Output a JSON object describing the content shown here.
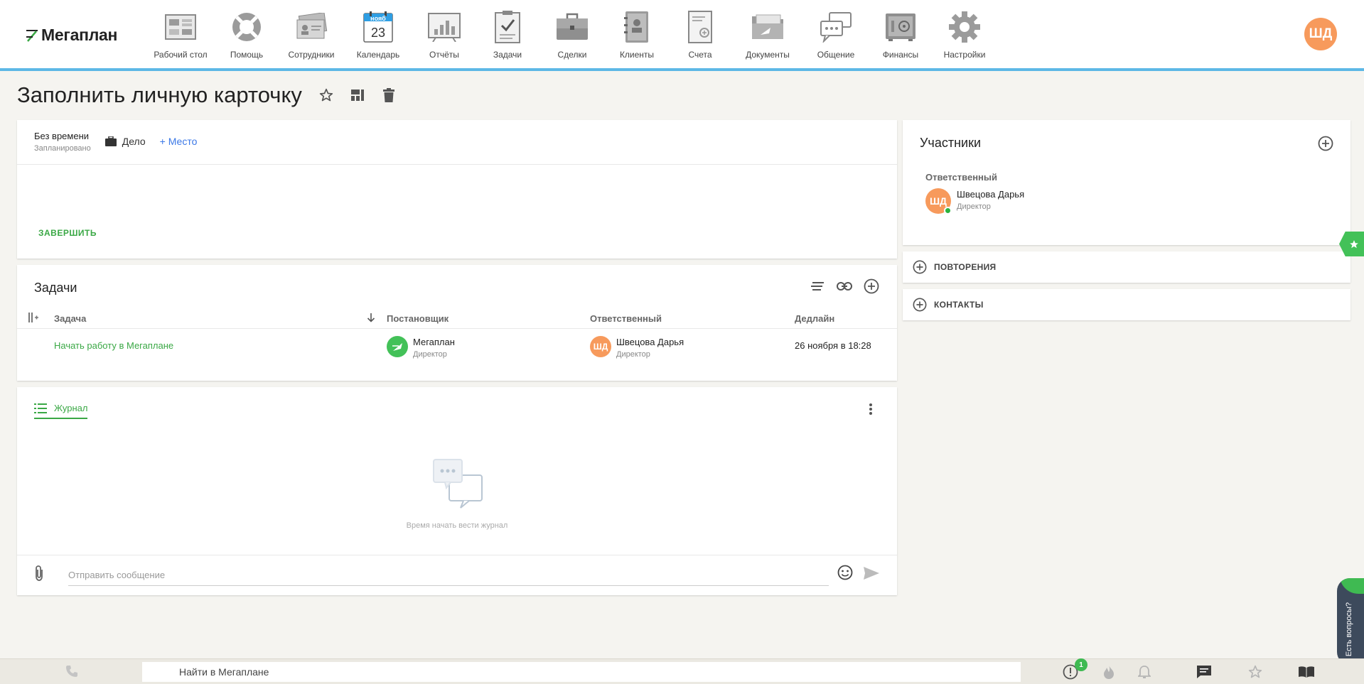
{
  "brand": {
    "logo_text": "Мегаплан"
  },
  "nav": {
    "items": [
      {
        "label": "Рабочий стол",
        "icon": "desktop-icon"
      },
      {
        "label": "Помощь",
        "icon": "lifebuoy-icon"
      },
      {
        "label": "Сотрудники",
        "icon": "employees-icon"
      },
      {
        "label": "Календарь",
        "icon": "calendar-icon",
        "cal_month": "нояб",
        "cal_day": "23"
      },
      {
        "label": "Отчёты",
        "icon": "reports-icon"
      },
      {
        "label": "Задачи",
        "icon": "tasks-icon"
      },
      {
        "label": "Сделки",
        "icon": "deals-icon"
      },
      {
        "label": "Клиенты",
        "icon": "clients-icon"
      },
      {
        "label": "Счета",
        "icon": "invoices-icon"
      },
      {
        "label": "Документы",
        "icon": "documents-icon"
      },
      {
        "label": "Общение",
        "icon": "chat-icon"
      },
      {
        "label": "Финансы",
        "icon": "safe-icon"
      },
      {
        "label": "Настройки",
        "icon": "gear-icon"
      }
    ],
    "user_initials": "ШД"
  },
  "page": {
    "title": "Заполнить личную карточку"
  },
  "event": {
    "time": "Без времени",
    "status": "Запланировано",
    "type": "Дело",
    "add_place": "+ Место",
    "finish_label": "ЗАВЕРШИТЬ"
  },
  "tasks": {
    "title": "Задачи",
    "columns": [
      "Задача",
      "Постановщик",
      "Ответственный",
      "Дедлайн"
    ],
    "rows": [
      {
        "task": "Начать работу в Мегаплане",
        "setter_name": "Мегаплан",
        "setter_role": "Директор",
        "resp_initials": "ШД",
        "resp_name": "Швецова Дарья",
        "resp_role": "Директор",
        "deadline": "26 ноября в 18:28"
      }
    ]
  },
  "journal": {
    "tab_label": "Журнал",
    "empty_text": "Время начать вести журнал",
    "message_placeholder": "Отправить сообщение"
  },
  "participants": {
    "title": "Участники",
    "role_label": "Ответственный",
    "person_initials": "ШД",
    "person_name": "Швецова Дарья",
    "person_role": "Директор"
  },
  "sections": {
    "repeats": "ПОВТОРЕНИЯ",
    "contacts": "КОНТАКТЫ"
  },
  "help": {
    "label": "Есть вопросы?"
  },
  "bottombar": {
    "search_placeholder": "Найти в Мегаплане",
    "alerts_count": "1"
  },
  "colors": {
    "accent_green": "#3aa845",
    "link_blue": "#3b78e7",
    "avatar_orange": "#f79a5c",
    "topbar_line": "#5db8e6"
  }
}
